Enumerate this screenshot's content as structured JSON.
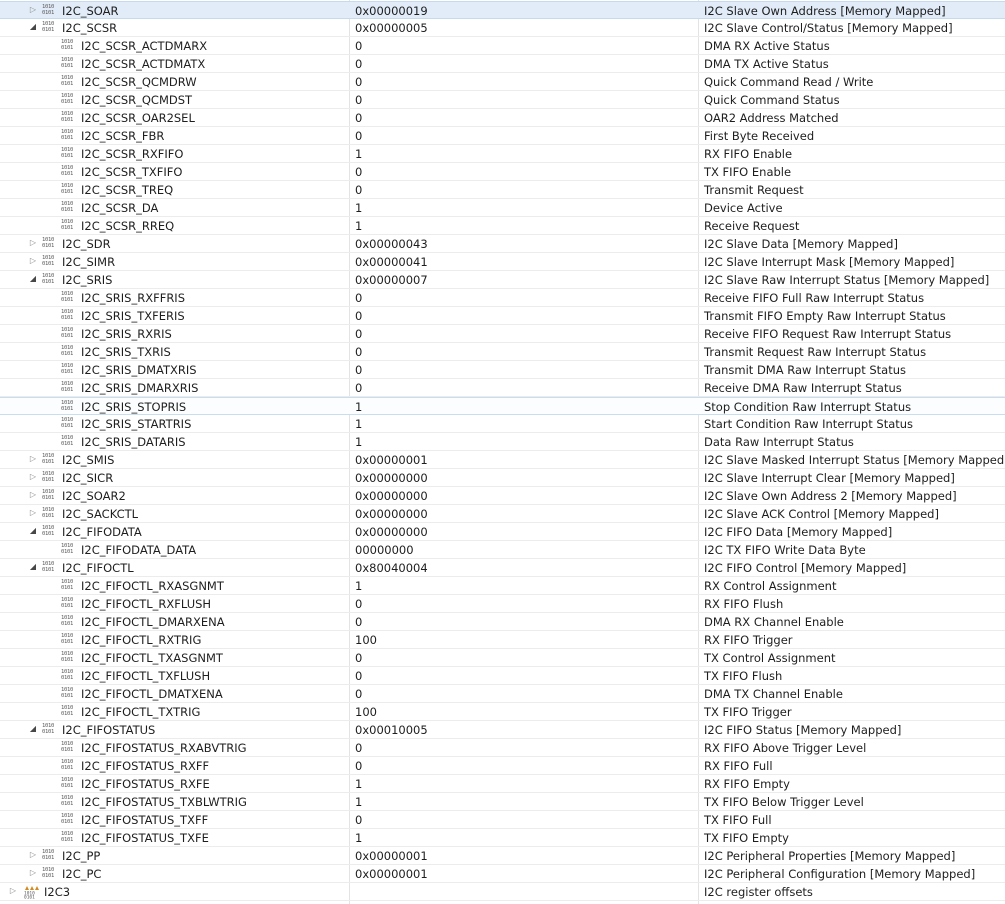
{
  "rows": [
    {
      "name": "I2C_SOAR",
      "value": "0x00000019",
      "description": "I2C Slave Own Address [Memory Mapped]",
      "level": 1,
      "expander": "collapsed",
      "selected": true
    },
    {
      "name": "I2C_SCSR",
      "value": "0x00000005",
      "description": "I2C Slave Control/Status [Memory Mapped]",
      "level": 1,
      "expander": "expanded"
    },
    {
      "name": "I2C_SCSR_ACTDMARX",
      "value": "0",
      "description": "DMA RX Active Status",
      "level": 2
    },
    {
      "name": "I2C_SCSR_ACTDMATX",
      "value": "0",
      "description": "DMA TX Active Status",
      "level": 2
    },
    {
      "name": "I2C_SCSR_QCMDRW",
      "value": "0",
      "description": "Quick Command Read / Write",
      "level": 2
    },
    {
      "name": "I2C_SCSR_QCMDST",
      "value": "0",
      "description": "Quick Command Status",
      "level": 2
    },
    {
      "name": "I2C_SCSR_OAR2SEL",
      "value": "0",
      "description": "OAR2 Address Matched",
      "level": 2
    },
    {
      "name": "I2C_SCSR_FBR",
      "value": "0",
      "description": "First Byte Received",
      "level": 2
    },
    {
      "name": "I2C_SCSR_RXFIFO",
      "value": "1",
      "description": "RX FIFO Enable",
      "level": 2
    },
    {
      "name": "I2C_SCSR_TXFIFO",
      "value": "0",
      "description": "TX FIFO Enable",
      "level": 2
    },
    {
      "name": "I2C_SCSR_TREQ",
      "value": "0",
      "description": "Transmit Request",
      "level": 2
    },
    {
      "name": "I2C_SCSR_DA",
      "value": "1",
      "description": "Device Active",
      "level": 2
    },
    {
      "name": "I2C_SCSR_RREQ",
      "value": "1",
      "description": "Receive Request",
      "level": 2
    },
    {
      "name": "I2C_SDR",
      "value": "0x00000043",
      "description": "I2C Slave Data [Memory Mapped]",
      "level": 1,
      "expander": "collapsed"
    },
    {
      "name": "I2C_SIMR",
      "value": "0x00000041",
      "description": "I2C Slave Interrupt Mask [Memory Mapped]",
      "level": 1,
      "expander": "collapsed"
    },
    {
      "name": "I2C_SRIS",
      "value": "0x00000007",
      "description": "I2C Slave Raw Interrupt Status [Memory Mapped]",
      "level": 1,
      "expander": "expanded"
    },
    {
      "name": "I2C_SRIS_RXFFRIS",
      "value": "0",
      "description": "Receive FIFO Full Raw Interrupt Status",
      "level": 2
    },
    {
      "name": "I2C_SRIS_TXFERIS",
      "value": "0",
      "description": "Transmit FIFO Empty Raw Interrupt Status",
      "level": 2
    },
    {
      "name": "I2C_SRIS_RXRIS",
      "value": "0",
      "description": "Receive FIFO Request Raw Interrupt Status",
      "level": 2
    },
    {
      "name": "I2C_SRIS_TXRIS",
      "value": "0",
      "description": "Transmit Request Raw Interrupt Status",
      "level": 2
    },
    {
      "name": "I2C_SRIS_DMATXRIS",
      "value": "0",
      "description": "Transmit DMA Raw Interrupt Status",
      "level": 2
    },
    {
      "name": "I2C_SRIS_DMARXRIS",
      "value": "0",
      "description": "Receive DMA Raw Interrupt Status",
      "level": 2
    },
    {
      "name": "I2C_SRIS_STOPRIS",
      "value": "1",
      "description": "Stop Condition Raw Interrupt Status",
      "level": 2,
      "hovered": true
    },
    {
      "name": "I2C_SRIS_STARTRIS",
      "value": "1",
      "description": "Start Condition Raw Interrupt Status",
      "level": 2
    },
    {
      "name": "I2C_SRIS_DATARIS",
      "value": "1",
      "description": "Data Raw Interrupt Status",
      "level": 2
    },
    {
      "name": "I2C_SMIS",
      "value": "0x00000001",
      "description": "I2C Slave Masked Interrupt Status [Memory Mapped]",
      "level": 1,
      "expander": "collapsed"
    },
    {
      "name": "I2C_SICR",
      "value": "0x00000000",
      "description": "I2C Slave Interrupt Clear [Memory Mapped]",
      "level": 1,
      "expander": "collapsed"
    },
    {
      "name": "I2C_SOAR2",
      "value": "0x00000000",
      "description": "I2C Slave Own Address 2 [Memory Mapped]",
      "level": 1,
      "expander": "collapsed"
    },
    {
      "name": "I2C_SACKCTL",
      "value": "0x00000000",
      "description": "I2C Slave ACK Control [Memory Mapped]",
      "level": 1,
      "expander": "collapsed"
    },
    {
      "name": "I2C_FIFODATA",
      "value": "0x00000000",
      "description": "I2C FIFO Data [Memory Mapped]",
      "level": 1,
      "expander": "expanded"
    },
    {
      "name": "I2C_FIFODATA_DATA",
      "value": "00000000",
      "description": "I2C TX FIFO Write Data Byte",
      "level": 2
    },
    {
      "name": "I2C_FIFOCTL",
      "value": "0x80040004",
      "description": "I2C FIFO Control [Memory Mapped]",
      "level": 1,
      "expander": "expanded"
    },
    {
      "name": "I2C_FIFOCTL_RXASGNMT",
      "value": "1",
      "description": "RX Control Assignment",
      "level": 2
    },
    {
      "name": "I2C_FIFOCTL_RXFLUSH",
      "value": "0",
      "description": "RX FIFO Flush",
      "level": 2
    },
    {
      "name": "I2C_FIFOCTL_DMARXENA",
      "value": "0",
      "description": "DMA RX Channel Enable",
      "level": 2
    },
    {
      "name": "I2C_FIFOCTL_RXTRIG",
      "value": "100",
      "description": "RX FIFO Trigger",
      "level": 2
    },
    {
      "name": "I2C_FIFOCTL_TXASGNMT",
      "value": "0",
      "description": "TX Control Assignment",
      "level": 2
    },
    {
      "name": "I2C_FIFOCTL_TXFLUSH",
      "value": "0",
      "description": "TX FIFO Flush",
      "level": 2
    },
    {
      "name": "I2C_FIFOCTL_DMATXENA",
      "value": "0",
      "description": "DMA TX Channel Enable",
      "level": 2
    },
    {
      "name": "I2C_FIFOCTL_TXTRIG",
      "value": "100",
      "description": "TX FIFO Trigger",
      "level": 2
    },
    {
      "name": "I2C_FIFOSTATUS",
      "value": "0x00010005",
      "description": "I2C FIFO Status [Memory Mapped]",
      "level": 1,
      "expander": "expanded"
    },
    {
      "name": "I2C_FIFOSTATUS_RXABVTRIG",
      "value": "0",
      "description": "RX FIFO Above Trigger Level",
      "level": 2
    },
    {
      "name": "I2C_FIFOSTATUS_RXFF",
      "value": "0",
      "description": "RX FIFO Full",
      "level": 2
    },
    {
      "name": "I2C_FIFOSTATUS_RXFE",
      "value": "1",
      "description": "RX FIFO Empty",
      "level": 2
    },
    {
      "name": "I2C_FIFOSTATUS_TXBLWTRIG",
      "value": "1",
      "description": "TX FIFO Below Trigger Level",
      "level": 2
    },
    {
      "name": "I2C_FIFOSTATUS_TXFF",
      "value": "0",
      "description": "TX FIFO Full",
      "level": 2
    },
    {
      "name": "I2C_FIFOSTATUS_TXFE",
      "value": "1",
      "description": "TX FIFO Empty",
      "level": 2
    },
    {
      "name": "I2C_PP",
      "value": "0x00000001",
      "description": "I2C Peripheral Properties [Memory Mapped]",
      "level": 1,
      "expander": "collapsed"
    },
    {
      "name": "I2C_PC",
      "value": "0x00000001",
      "description": "I2C Peripheral Configuration [Memory Mapped]",
      "level": 1,
      "expander": "collapsed"
    },
    {
      "name": "I2C3",
      "value": "",
      "description": "I2C register offsets",
      "level": 0,
      "expander": "collapsed",
      "icon": "peripheral-group-icon"
    }
  ],
  "register_icon_glyph": [
    "1010",
    "0101"
  ]
}
